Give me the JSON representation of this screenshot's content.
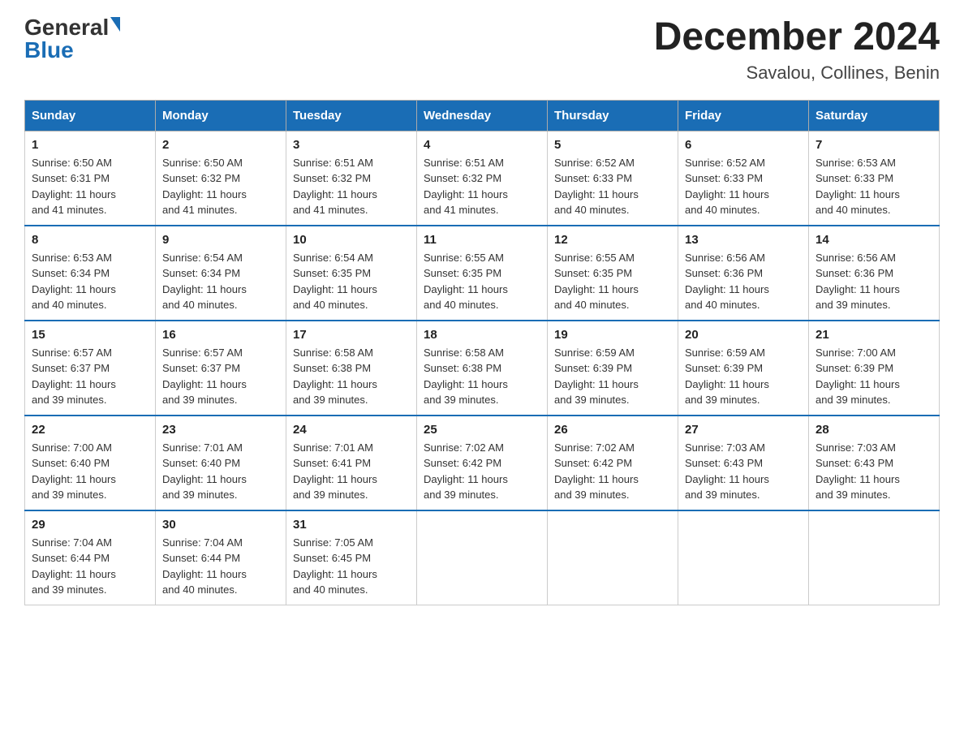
{
  "header": {
    "logo_general": "General",
    "logo_blue": "Blue",
    "month_title": "December 2024",
    "location": "Savalou, Collines, Benin"
  },
  "days_of_week": [
    "Sunday",
    "Monday",
    "Tuesday",
    "Wednesday",
    "Thursday",
    "Friday",
    "Saturday"
  ],
  "weeks": [
    [
      {
        "num": "1",
        "sunrise": "6:50 AM",
        "sunset": "6:31 PM",
        "daylight": "11 hours and 41 minutes."
      },
      {
        "num": "2",
        "sunrise": "6:50 AM",
        "sunset": "6:32 PM",
        "daylight": "11 hours and 41 minutes."
      },
      {
        "num": "3",
        "sunrise": "6:51 AM",
        "sunset": "6:32 PM",
        "daylight": "11 hours and 41 minutes."
      },
      {
        "num": "4",
        "sunrise": "6:51 AM",
        "sunset": "6:32 PM",
        "daylight": "11 hours and 41 minutes."
      },
      {
        "num": "5",
        "sunrise": "6:52 AM",
        "sunset": "6:33 PM",
        "daylight": "11 hours and 40 minutes."
      },
      {
        "num": "6",
        "sunrise": "6:52 AM",
        "sunset": "6:33 PM",
        "daylight": "11 hours and 40 minutes."
      },
      {
        "num": "7",
        "sunrise": "6:53 AM",
        "sunset": "6:33 PM",
        "daylight": "11 hours and 40 minutes."
      }
    ],
    [
      {
        "num": "8",
        "sunrise": "6:53 AM",
        "sunset": "6:34 PM",
        "daylight": "11 hours and 40 minutes."
      },
      {
        "num": "9",
        "sunrise": "6:54 AM",
        "sunset": "6:34 PM",
        "daylight": "11 hours and 40 minutes."
      },
      {
        "num": "10",
        "sunrise": "6:54 AM",
        "sunset": "6:35 PM",
        "daylight": "11 hours and 40 minutes."
      },
      {
        "num": "11",
        "sunrise": "6:55 AM",
        "sunset": "6:35 PM",
        "daylight": "11 hours and 40 minutes."
      },
      {
        "num": "12",
        "sunrise": "6:55 AM",
        "sunset": "6:35 PM",
        "daylight": "11 hours and 40 minutes."
      },
      {
        "num": "13",
        "sunrise": "6:56 AM",
        "sunset": "6:36 PM",
        "daylight": "11 hours and 40 minutes."
      },
      {
        "num": "14",
        "sunrise": "6:56 AM",
        "sunset": "6:36 PM",
        "daylight": "11 hours and 39 minutes."
      }
    ],
    [
      {
        "num": "15",
        "sunrise": "6:57 AM",
        "sunset": "6:37 PM",
        "daylight": "11 hours and 39 minutes."
      },
      {
        "num": "16",
        "sunrise": "6:57 AM",
        "sunset": "6:37 PM",
        "daylight": "11 hours and 39 minutes."
      },
      {
        "num": "17",
        "sunrise": "6:58 AM",
        "sunset": "6:38 PM",
        "daylight": "11 hours and 39 minutes."
      },
      {
        "num": "18",
        "sunrise": "6:58 AM",
        "sunset": "6:38 PM",
        "daylight": "11 hours and 39 minutes."
      },
      {
        "num": "19",
        "sunrise": "6:59 AM",
        "sunset": "6:39 PM",
        "daylight": "11 hours and 39 minutes."
      },
      {
        "num": "20",
        "sunrise": "6:59 AM",
        "sunset": "6:39 PM",
        "daylight": "11 hours and 39 minutes."
      },
      {
        "num": "21",
        "sunrise": "7:00 AM",
        "sunset": "6:39 PM",
        "daylight": "11 hours and 39 minutes."
      }
    ],
    [
      {
        "num": "22",
        "sunrise": "7:00 AM",
        "sunset": "6:40 PM",
        "daylight": "11 hours and 39 minutes."
      },
      {
        "num": "23",
        "sunrise": "7:01 AM",
        "sunset": "6:40 PM",
        "daylight": "11 hours and 39 minutes."
      },
      {
        "num": "24",
        "sunrise": "7:01 AM",
        "sunset": "6:41 PM",
        "daylight": "11 hours and 39 minutes."
      },
      {
        "num": "25",
        "sunrise": "7:02 AM",
        "sunset": "6:42 PM",
        "daylight": "11 hours and 39 minutes."
      },
      {
        "num": "26",
        "sunrise": "7:02 AM",
        "sunset": "6:42 PM",
        "daylight": "11 hours and 39 minutes."
      },
      {
        "num": "27",
        "sunrise": "7:03 AM",
        "sunset": "6:43 PM",
        "daylight": "11 hours and 39 minutes."
      },
      {
        "num": "28",
        "sunrise": "7:03 AM",
        "sunset": "6:43 PM",
        "daylight": "11 hours and 39 minutes."
      }
    ],
    [
      {
        "num": "29",
        "sunrise": "7:04 AM",
        "sunset": "6:44 PM",
        "daylight": "11 hours and 39 minutes."
      },
      {
        "num": "30",
        "sunrise": "7:04 AM",
        "sunset": "6:44 PM",
        "daylight": "11 hours and 40 minutes."
      },
      {
        "num": "31",
        "sunrise": "7:05 AM",
        "sunset": "6:45 PM",
        "daylight": "11 hours and 40 minutes."
      },
      null,
      null,
      null,
      null
    ]
  ],
  "labels": {
    "sunrise": "Sunrise:",
    "sunset": "Sunset:",
    "daylight": "Daylight:"
  }
}
